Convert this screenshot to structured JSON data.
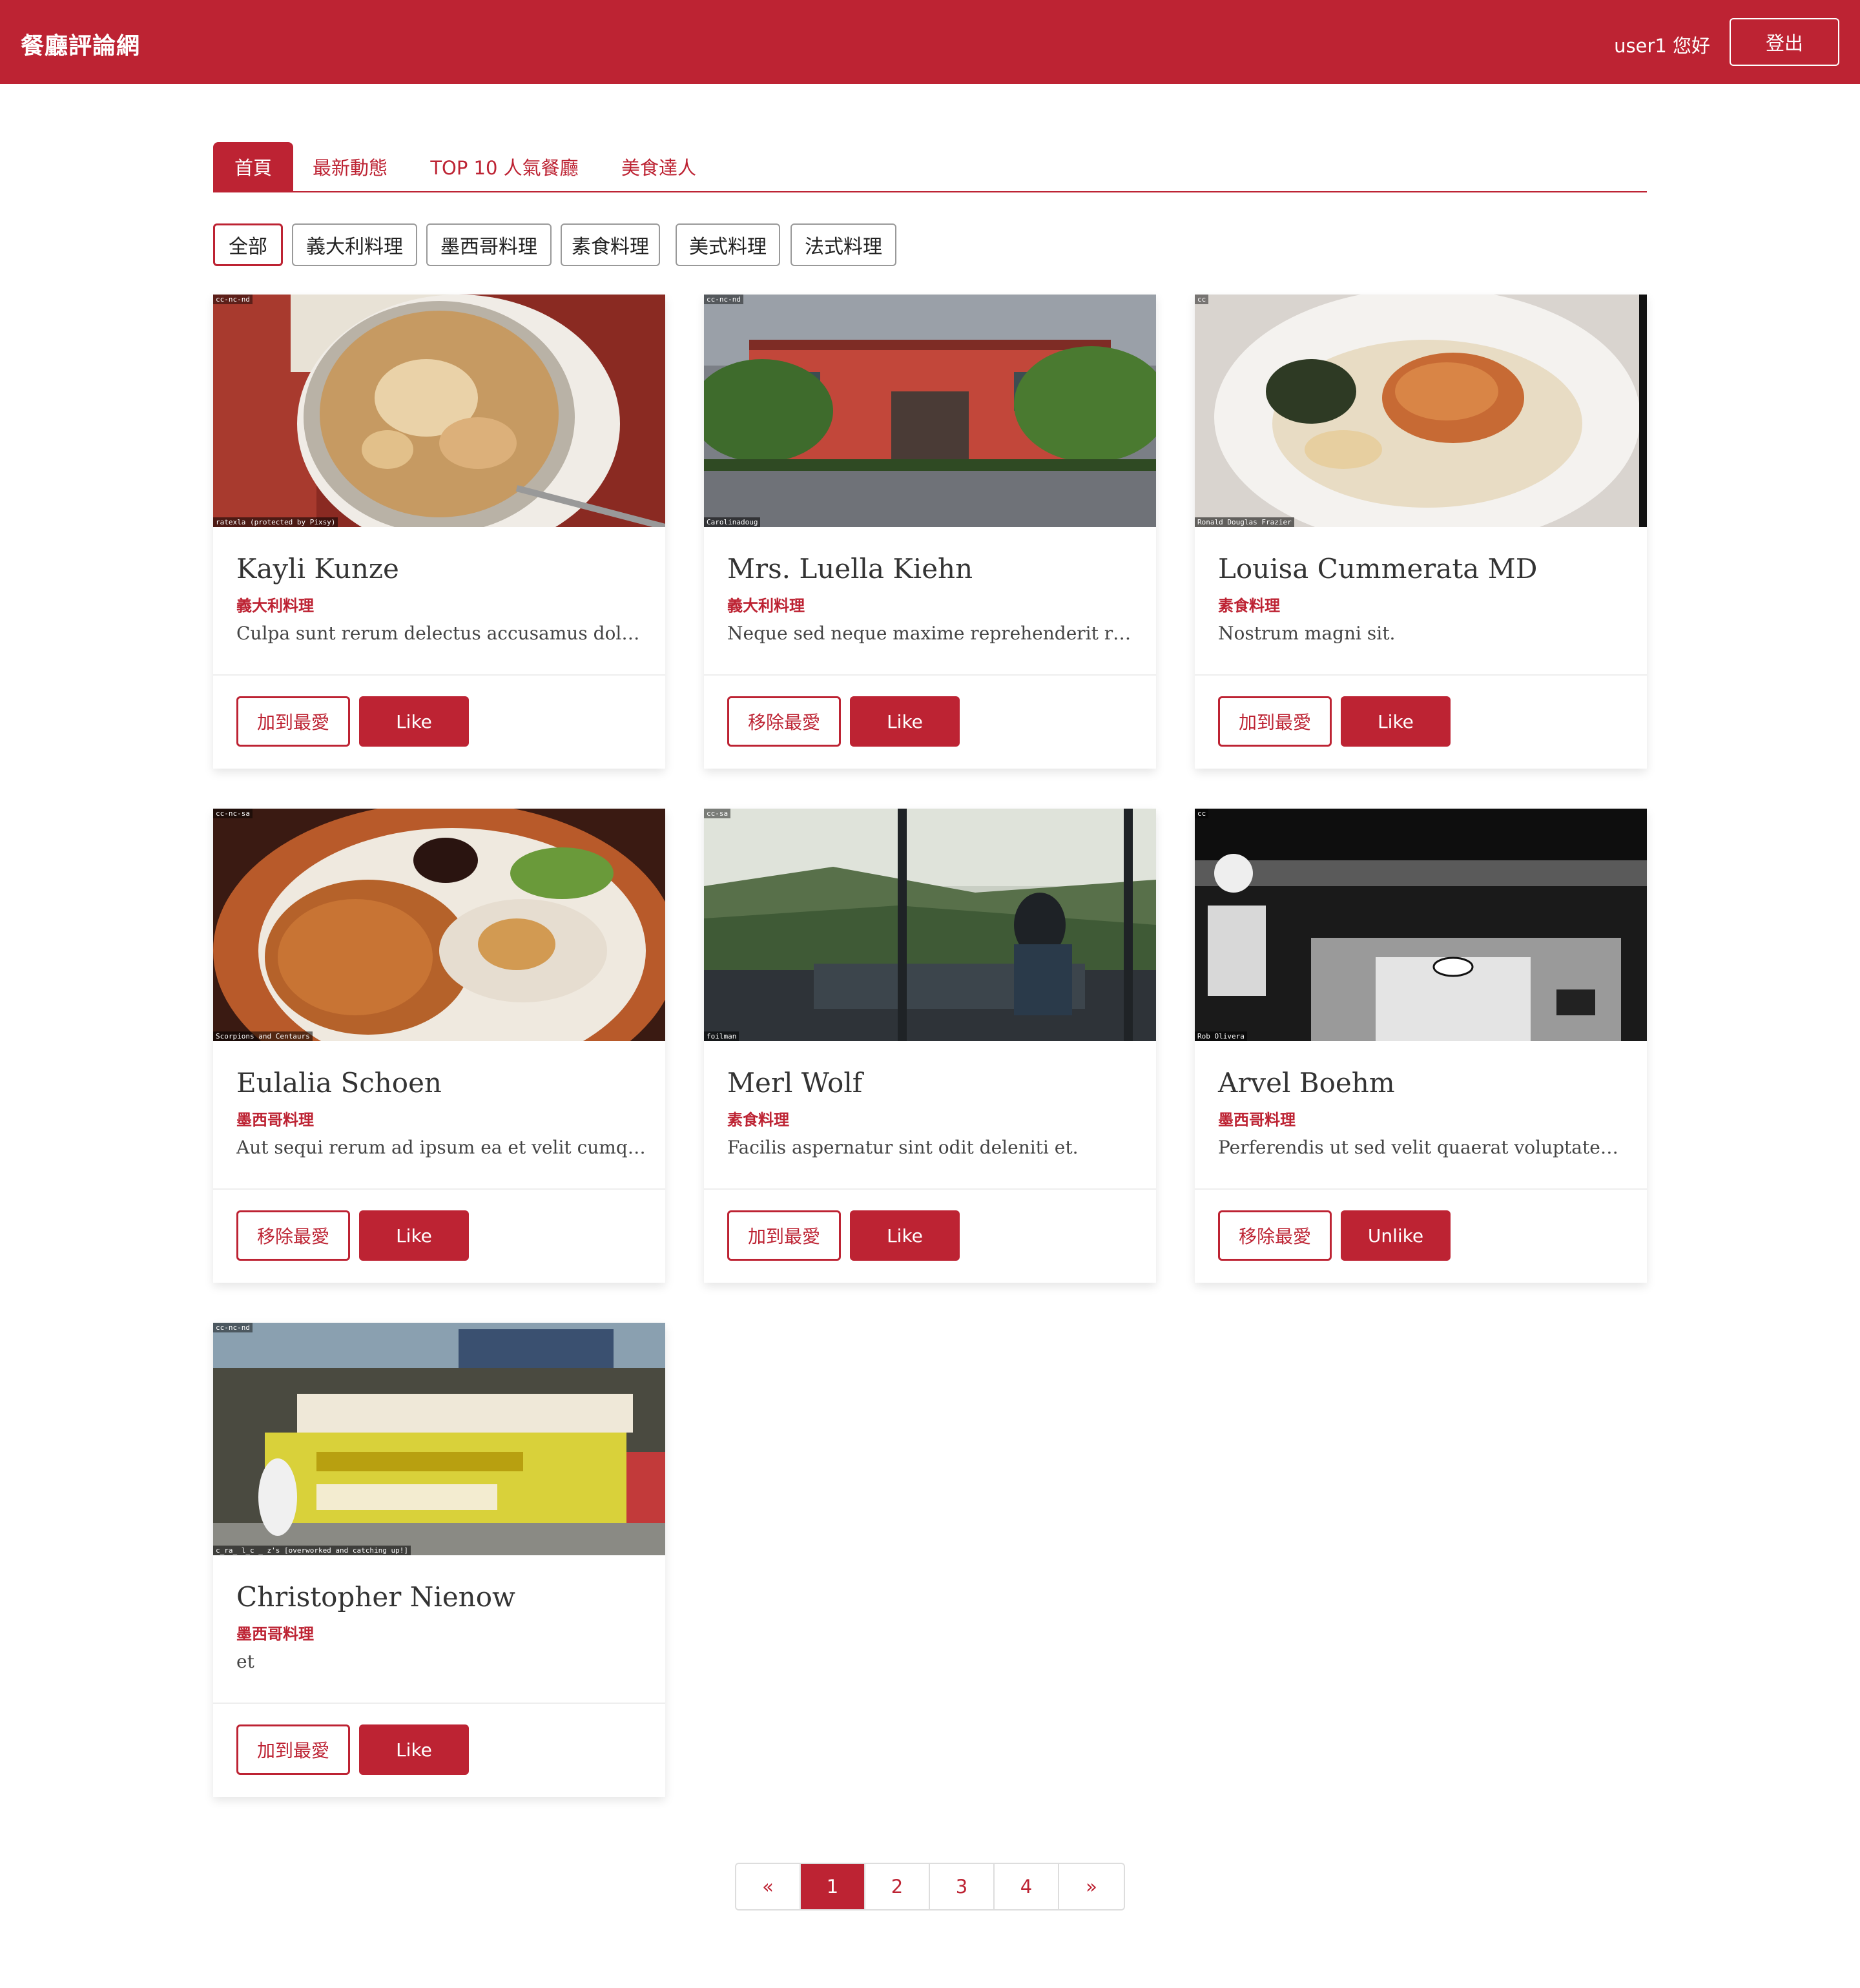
{
  "navbar": {
    "brand": "餐廳評論網",
    "greeting": "user1 您好",
    "logout_label": "登出"
  },
  "tabs": [
    {
      "label": "首頁",
      "active": true
    },
    {
      "label": "最新動態",
      "active": false
    },
    {
      "label": "TOP 10 人氣餐廳",
      "active": false
    },
    {
      "label": "美食達人",
      "active": false
    }
  ],
  "filters": [
    {
      "label": "全部",
      "active": true
    },
    {
      "label": "義大利料理",
      "active": false
    },
    {
      "label": "墨西哥料理",
      "active": false
    },
    {
      "label": "素食料理",
      "active": false
    },
    {
      "label": "美式料理",
      "active": false
    },
    {
      "label": "法式料理",
      "active": false
    }
  ],
  "restaurants": [
    {
      "name": "Kayli Kunze",
      "category": "義大利料理",
      "description": "Culpa sunt rerum delectus accusamus dolo…",
      "favorite_label": "加到最愛",
      "like_label": "Like",
      "image_license": "cc-nc-nd",
      "image_credit": "ratexla (protected by Pixsy)",
      "image_icon": "coffee-photo"
    },
    {
      "name": "Mrs. Luella Kiehn",
      "category": "義大利料理",
      "description": "Neque sed neque maxime reprehenderit re…",
      "favorite_label": "移除最愛",
      "like_label": "Like",
      "image_license": "cc-nc-nd",
      "image_credit": "Carolinadoug",
      "image_icon": "building-photo"
    },
    {
      "name": "Louisa Cummerata MD",
      "category": "素食料理",
      "description": "Nostrum magni sit.",
      "favorite_label": "加到最愛",
      "like_label": "Like",
      "image_license": "cc",
      "image_credit": "Ronald Douglas Frazier",
      "image_icon": "plated-dish-photo"
    },
    {
      "name": "Eulalia Schoen",
      "category": "墨西哥料理",
      "description": "Aut sequi rerum ad ipsum ea et velit cumq…",
      "favorite_label": "移除最愛",
      "like_label": "Like",
      "image_license": "cc-nc-sa",
      "image_credit": "Scorpions and Centaurs",
      "image_icon": "burrito-photo"
    },
    {
      "name": "Merl Wolf",
      "category": "素食料理",
      "description": "Facilis aspernatur sint odit deleniti et.",
      "favorite_label": "加到最愛",
      "like_label": "Like",
      "image_license": "cc-sa",
      "image_credit": "foilman",
      "image_icon": "diner-window-photo"
    },
    {
      "name": "Arvel Boehm",
      "category": "墨西哥料理",
      "description": "Perferendis ut sed velit quaerat voluptate…",
      "favorite_label": "移除最愛",
      "like_label": "Unlike",
      "image_license": "cc",
      "image_credit": "Rob Olivera",
      "image_icon": "storefront-photo"
    },
    {
      "name": "Christopher Nienow",
      "category": "墨西哥料理",
      "description": "et",
      "favorite_label": "加到最愛",
      "like_label": "Like",
      "image_license": "cc-nc-nd",
      "image_credit": "c_ra_ l_c _ z's [overworked and catching up!]",
      "image_icon": "sushi-shop-photo"
    }
  ],
  "pagination": {
    "prev": "«",
    "pages": [
      "1",
      "2",
      "3",
      "4"
    ],
    "current": "1",
    "next": "»"
  },
  "colors": {
    "brand_red": "#bd2333",
    "white": "#ffffff"
  }
}
